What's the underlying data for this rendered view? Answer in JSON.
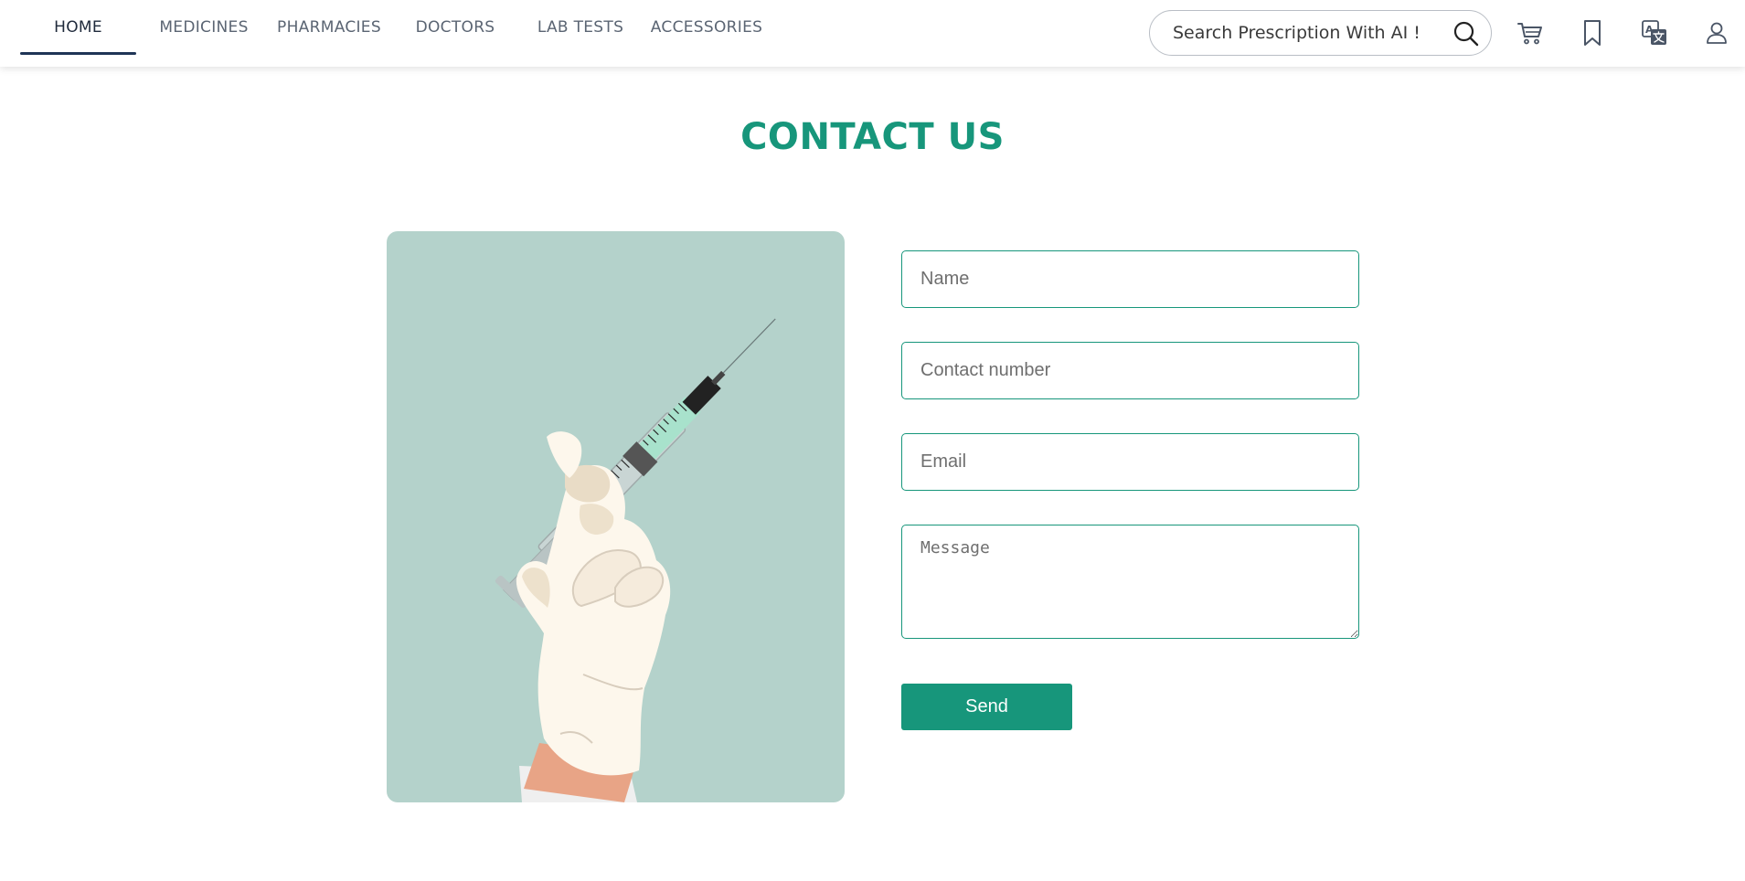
{
  "nav": {
    "items": [
      {
        "label": "HOME",
        "active": true
      },
      {
        "label": "MEDICINES",
        "active": false
      },
      {
        "label": "PHARMACIES",
        "active": false
      },
      {
        "label": "DOCTORS",
        "active": false
      },
      {
        "label": "LAB TESTS",
        "active": false
      },
      {
        "label": "ACCESSORIES",
        "active": false
      }
    ],
    "search": {
      "placeholder": "Search Prescription With AI !",
      "value": ""
    },
    "icons": [
      "search-icon",
      "cart-icon",
      "bookmark-icon",
      "translate-icon",
      "user-icon"
    ]
  },
  "page": {
    "title": "CONTACT US"
  },
  "form": {
    "name_placeholder": "Name",
    "contact_placeholder": "Contact number",
    "email_placeholder": "Email",
    "message_placeholder": "Message",
    "send_label": "Send"
  },
  "colors": {
    "accent": "#17967b",
    "nav_active": "#1f3556",
    "illustration_bg": "#b4d2cb"
  }
}
